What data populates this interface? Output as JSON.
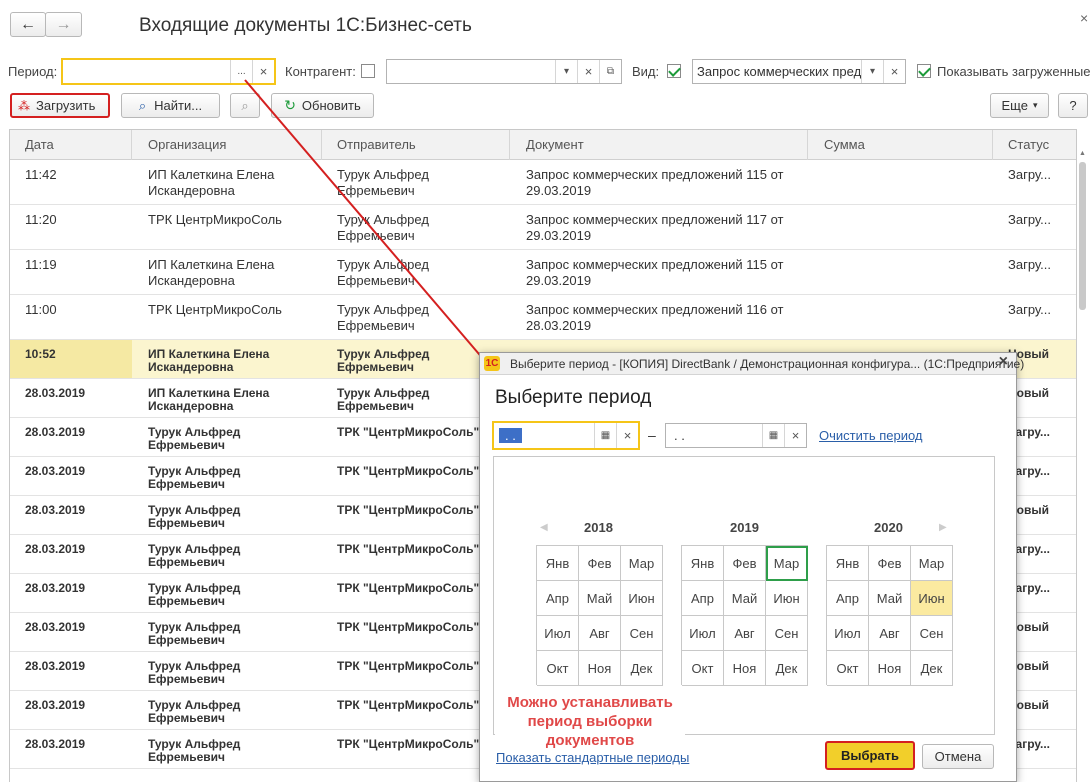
{
  "window": {
    "title": "Входящие документы 1С:Бизнес-сеть"
  },
  "nav": {
    "back": "←",
    "forward": "→"
  },
  "filters": {
    "period_label": "Период:",
    "period_value": "",
    "period_select": "...",
    "clear": "×",
    "contractor_label": "Контрагент:",
    "contractor_value": "",
    "kind_label": "Вид:",
    "kind_value": "Запрос коммерческих пред",
    "show_loaded_label": "Показывать загруженные"
  },
  "toolbar": {
    "load": "Загрузить",
    "find": "Найти...",
    "refresh": "Обновить",
    "more": "Еще",
    "help": "?"
  },
  "table": {
    "columns": [
      "Дата",
      "Организация",
      "Отправитель",
      "Документ",
      "Сумма",
      "Статус"
    ],
    "rows": [
      {
        "date": "11:42",
        "org": "ИП Калеткина Елена\nИскандеровна",
        "sender": "Турук Альфред\nЕфремьевич",
        "doc": "Запрос коммерческих предложений 115 от\n29.03.2019",
        "sum": "",
        "status": "Загру...",
        "bold": false
      },
      {
        "date": "11:20",
        "org": "ТРК ЦентрМикроСоль",
        "sender": "Турук Альфред\nЕфремьевич",
        "doc": "Запрос коммерческих предложений 117 от\n29.03.2019",
        "sum": "",
        "status": "Загру...",
        "bold": false
      },
      {
        "date": "11:19",
        "org": "ИП Калеткина Елена\nИскандеровна",
        "sender": "Турук Альфред\nЕфремьевич",
        "doc": "Запрос коммерческих предложений 115 от\n29.03.2019",
        "sum": "",
        "status": "Загру...",
        "bold": false
      },
      {
        "date": "11:00",
        "org": "ТРК ЦентрМикроСоль",
        "sender": "Турук Альфред\nЕфремьевич",
        "doc": "Запрос коммерческих предложений 116 от\n28.03.2019",
        "sum": "",
        "status": "Загру...",
        "bold": false
      },
      {
        "date": "10:52",
        "org": "ИП Калеткина Елена\nИскандеровна",
        "sender": "Турук Альфред\nЕфремьевич",
        "doc": "",
        "sum": "",
        "status": "Новый",
        "bold": true,
        "selected": true
      },
      {
        "date": "28.03.2019",
        "org": "ИП Калеткина Елена\nИскандеровна",
        "sender": "Турук Альфред\nЕфремьевич",
        "doc": "",
        "sum": "",
        "status": "Новый",
        "bold": true
      },
      {
        "date": "28.03.2019",
        "org": "Турук Альфред\nЕфремьевич",
        "sender": "ТРК \"ЦентрМикроСоль\"",
        "doc": "",
        "sum": "",
        "status": "Загру...",
        "bold": true
      },
      {
        "date": "28.03.2019",
        "org": "Турук Альфред\nЕфремьевич",
        "sender": "ТРК \"ЦентрМикроСоль\"",
        "doc": "",
        "sum": "",
        "status": "Загру...",
        "bold": true
      },
      {
        "date": "28.03.2019",
        "org": "Турук Альфред\nЕфремьевич",
        "sender": "ТРК \"ЦентрМикроСоль\"",
        "doc": "",
        "sum": "",
        "status": "Новый",
        "bold": true
      },
      {
        "date": "28.03.2019",
        "org": "Турук Альфред\nЕфремьевич",
        "sender": "ТРК \"ЦентрМикроСоль\"",
        "doc": "",
        "sum": "",
        "status": "Загру...",
        "bold": true
      },
      {
        "date": "28.03.2019",
        "org": "Турук Альфред\nЕфремьевич",
        "sender": "ТРК \"ЦентрМикроСоль\"",
        "doc": "",
        "sum": "",
        "status": "Загру...",
        "bold": true
      },
      {
        "date": "28.03.2019",
        "org": "Турук Альфред\nЕфремьевич",
        "sender": "ТРК \"ЦентрМикроСоль\"",
        "doc": "",
        "sum": "",
        "status": "Новый",
        "bold": true
      },
      {
        "date": "28.03.2019",
        "org": "Турук Альфред\nЕфремьевич",
        "sender": "ТРК \"ЦентрМикроСоль\"",
        "doc": "",
        "sum": "",
        "status": "Новый",
        "bold": true
      },
      {
        "date": "28.03.2019",
        "org": "Турук Альфред\nЕфремьевич",
        "sender": "ТРК \"ЦентрМикроСоль\"",
        "doc": "",
        "sum": "",
        "status": "Новый",
        "bold": true
      },
      {
        "date": "28.03.2019",
        "org": "Турук Альфред\nЕфремьевич",
        "sender": "ТРК \"ЦентрМикроСоль\"",
        "doc": "",
        "sum": "",
        "status": "Загру...",
        "bold": true
      }
    ]
  },
  "dialog": {
    "window_title": "Выберите период - [КОПИЯ] DirectBank / Демонстрационная конфигура...  (1С:Предприятие)",
    "close": "×",
    "heading": "Выберите период",
    "start_date": " .  .",
    "end_date": " .  .",
    "dash": "–",
    "clear_period": "Очистить период",
    "prev": "◀",
    "next": "▶",
    "years": [
      {
        "year": "2018",
        "months": [
          "Янв",
          "Фев",
          "Мар",
          "Апр",
          "Май",
          "Июн",
          "Июл",
          "Авг",
          "Сен",
          "Окт",
          "Ноя",
          "Дек"
        ],
        "current": -1,
        "highlight": -1
      },
      {
        "year": "2019",
        "months": [
          "Янв",
          "Фев",
          "Мар",
          "Апр",
          "Май",
          "Июн",
          "Июл",
          "Авг",
          "Сен",
          "Окт",
          "Ноя",
          "Дек"
        ],
        "current": 2,
        "highlight": -1
      },
      {
        "year": "2020",
        "months": [
          "Янв",
          "Фев",
          "Мар",
          "Апр",
          "Май",
          "Июн",
          "Июл",
          "Авг",
          "Сен",
          "Окт",
          "Ноя",
          "Дек"
        ],
        "current": -1,
        "highlight": 5
      }
    ],
    "annotation": "Можно устанавливать\nпериод выборки\nдокументов",
    "show_standard": "Показать стандартные периоды",
    "select": "Выбрать",
    "cancel": "Отмена"
  },
  "colors": {
    "accent_red": "#d42020",
    "highlight_yellow": "#f5c518",
    "select_button": "#f2cf2a",
    "current_month_border": "#2e9e4a",
    "highlight_month": "#fbeaa0",
    "link": "#2a5ea8"
  }
}
